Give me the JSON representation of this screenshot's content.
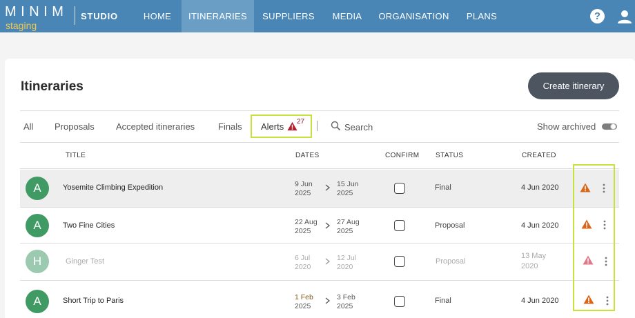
{
  "brand": {
    "name": "MINIM",
    "environment": "staging",
    "product": "STUDIO"
  },
  "nav": {
    "items": [
      {
        "label": "HOME"
      },
      {
        "label": "ITINERARIES",
        "active": true
      },
      {
        "label": "SUPPLIERS"
      },
      {
        "label": "MEDIA"
      },
      {
        "label": "ORGANISATION"
      },
      {
        "label": "PLANS"
      }
    ],
    "help_glyph": "?"
  },
  "page": {
    "title": "Itineraries",
    "create_button": "Create itinerary"
  },
  "filters": {
    "tabs": [
      {
        "label": "All"
      },
      {
        "label": "Proposals"
      },
      {
        "label": "Accepted itineraries"
      },
      {
        "label": "Finals"
      }
    ],
    "alerts": {
      "label": "Alerts",
      "count": "27"
    },
    "search_label": "Search",
    "show_archived_label": "Show archived"
  },
  "table": {
    "headers": {
      "title": "TITLE",
      "dates": "DATES",
      "confirm": "CONFIRM",
      "status": "STATUS",
      "created": "CREATED"
    },
    "rows": [
      {
        "initial": "A",
        "title": "Yosemite Climbing Expedition",
        "start_day": "9 Jun",
        "start_year": "2025",
        "end_day": "15 Jun",
        "end_year": "2025",
        "status": "Final",
        "created": "4 Jun 2020"
      },
      {
        "initial": "A",
        "title": "Two Fine Cities",
        "start_day": "22 Aug",
        "start_year": "2025",
        "end_day": "27 Aug",
        "end_year": "2025",
        "status": "Proposal",
        "created": "4 Jun 2020"
      },
      {
        "initial": "H",
        "title": "Ginger Test",
        "start_day": "6 Jul",
        "start_year": "2020",
        "end_day": "12 Jul",
        "end_year": "2020",
        "status": "Proposal",
        "created_line1": "13 May",
        "created_line2": "2020",
        "archived": true
      },
      {
        "initial": "A",
        "title": "Short Trip to Paris",
        "start_day": "1 Feb",
        "start_year": "2025",
        "end_day": "3 Feb",
        "end_year": "2025",
        "status": "Final",
        "created": "4 Jun 2020"
      }
    ]
  },
  "colors": {
    "nav_bg": "#4a86b5",
    "nav_active": "#6b9ec4",
    "avatar_green": "#3f9a63",
    "avatar_faded": "#9ccab0",
    "warning_orange": "#d9661b",
    "warning_faded": "#e07a8a",
    "alert_red": "#b51d2e",
    "highlight": "#c6e23c"
  }
}
